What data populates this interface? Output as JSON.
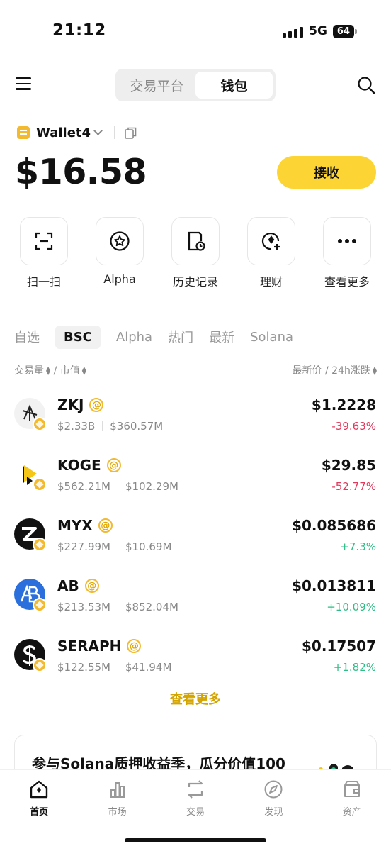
{
  "status": {
    "time": "21:12",
    "network": "5G",
    "battery": "64"
  },
  "topnav": {
    "tabs": [
      "交易平台",
      "钱包"
    ],
    "active_tab": "钱包"
  },
  "wallet": {
    "name": "Wallet4",
    "balance": "$16.58",
    "receive_label": "接收"
  },
  "actions": [
    {
      "label": "扫一扫",
      "icon": "scan-icon"
    },
    {
      "label": "Alpha",
      "icon": "alpha-star-icon"
    },
    {
      "label": "历史记录",
      "icon": "history-icon"
    },
    {
      "label": "理财",
      "icon": "earn-icon"
    },
    {
      "label": "查看更多",
      "icon": "more-icon"
    }
  ],
  "filter_tabs": [
    "自选",
    "BSC",
    "Alpha",
    "热门",
    "最新",
    "Solana"
  ],
  "active_filter": "BSC",
  "sort": {
    "left_a": "交易量",
    "left_sep": "/",
    "left_b": "市值",
    "right_a": "最新价",
    "right_sep": "/",
    "right_b": "24h涨跌"
  },
  "tokens": [
    {
      "symbol": "ZKJ",
      "volume": "$2.33B",
      "mcap": "$360.57M",
      "price": "$1.2228",
      "change": "-39.63%",
      "direction": "down",
      "logo": "zkj-logo"
    },
    {
      "symbol": "KOGE",
      "volume": "$562.21M",
      "mcap": "$102.29M",
      "price": "$29.85",
      "change": "-52.77%",
      "direction": "down",
      "logo": "koge-logo"
    },
    {
      "symbol": "MYX",
      "volume": "$227.99M",
      "mcap": "$10.69M",
      "price": "$0.085686",
      "change": "+7.3%",
      "direction": "up",
      "logo": "myx-logo"
    },
    {
      "symbol": "AB",
      "volume": "$213.53M",
      "mcap": "$852.04M",
      "price": "$0.013811",
      "change": "+10.09%",
      "direction": "up",
      "logo": "ab-logo"
    },
    {
      "symbol": "SERAPH",
      "volume": "$122.55M",
      "mcap": "$41.94M",
      "price": "$0.17507",
      "change": "+1.82%",
      "direction": "up",
      "logo": "seraph-logo"
    }
  ],
  "see_more": "查看更多",
  "promo": {
    "text": "参与Solana质押收益季，瓜分价值100"
  },
  "bottom_nav": [
    {
      "label": "首页",
      "icon": "home-icon",
      "active": true
    },
    {
      "label": "市场",
      "icon": "market-icon",
      "active": false
    },
    {
      "label": "交易",
      "icon": "trade-icon",
      "active": false
    },
    {
      "label": "发现",
      "icon": "discover-icon",
      "active": false
    },
    {
      "label": "资产",
      "icon": "assets-icon",
      "active": false
    }
  ],
  "colors": {
    "accent": "#fcd535",
    "up": "#2ebd85",
    "down": "#e0395b",
    "gold_text": "#d4a400"
  }
}
